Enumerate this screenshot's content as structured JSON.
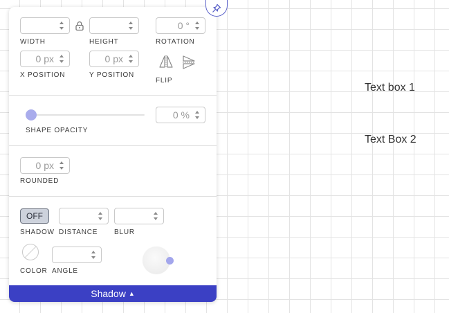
{
  "canvas": {
    "text_box_1": "Text box 1",
    "text_box_2": "Text Box 2"
  },
  "panel": {
    "pin_icon": "pin-icon",
    "size": {
      "width_label": "WIDTH",
      "width_value": "",
      "lock_icon": "lock-icon",
      "height_label": "HEIGHT",
      "height_value": "",
      "rotation_label": "ROTATION",
      "rotation_value": "0 °"
    },
    "position": {
      "x_label": "X POSITION",
      "x_value": "0 px",
      "y_label": "Y POSITION",
      "y_value": "0 px",
      "flip_label": "FLIP",
      "flip_horizontal_icon": "flip-horizontal-icon",
      "flip_vertical_icon": "flip-vertical-icon"
    },
    "opacity": {
      "label": "SHAPE OPACITY",
      "value": "0 %",
      "slider_fraction": 0
    },
    "rounded": {
      "label": "ROUNDED",
      "value": "0 px"
    },
    "shadow": {
      "toggle_label": "OFF",
      "shadow_label": "SHADOW",
      "distance_label": "DISTANCE",
      "distance_value": "",
      "blur_label": "BLUR",
      "blur_value": "",
      "color_label": "COLOR",
      "angle_label": "ANGLE",
      "angle_value": ""
    },
    "footer": {
      "title": "Shadow",
      "caret": "▲"
    }
  },
  "colors": {
    "accent": "#3b40c4",
    "slider_thumb": "#a9acec",
    "angle_handle": "#a3a6ec",
    "pin_border": "#5b62c9"
  }
}
